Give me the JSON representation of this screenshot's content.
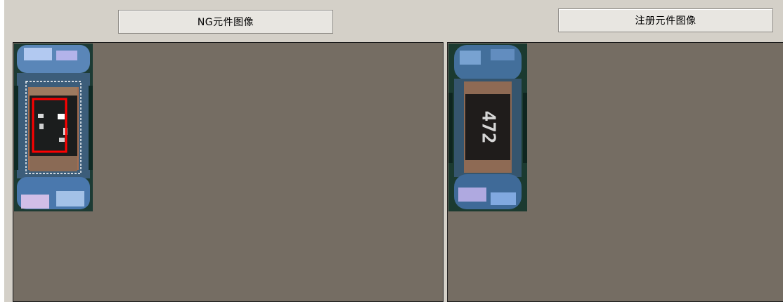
{
  "panels": {
    "ng": {
      "label": "NG元件图像"
    },
    "registered": {
      "label": "注册元件图像",
      "component_marking": "472"
    }
  },
  "colors": {
    "window_background": "#d4d0c8",
    "view_background": "#756d63",
    "defect_box": "#ff0000",
    "inspection_region": "#ffffff"
  }
}
